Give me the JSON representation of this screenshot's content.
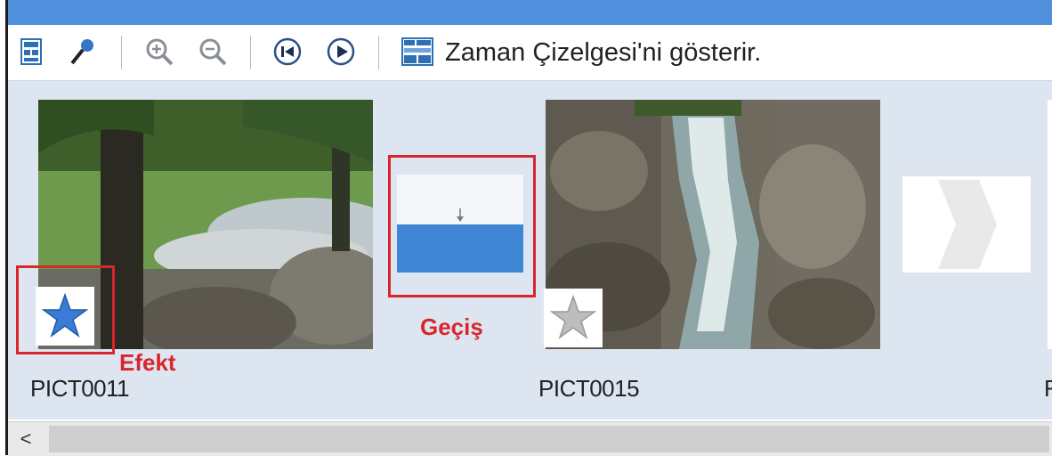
{
  "toolbar": {
    "buttons": [
      {
        "name": "storyboard-icon"
      },
      {
        "name": "narrate-mic-icon"
      },
      {
        "name": "zoom-in-icon"
      },
      {
        "name": "zoom-out-icon"
      },
      {
        "name": "rewind-icon"
      },
      {
        "name": "play-icon"
      },
      {
        "name": "timeline-icon"
      }
    ],
    "show_timeline_label": "Zaman Çizelgesi'ni gösterir."
  },
  "storyboard": {
    "clips": [
      {
        "name": "PICT0011",
        "has_effect": true
      },
      {
        "name": "PICT0015",
        "has_effect": false
      }
    ],
    "annotations": {
      "effect_label": "Efekt",
      "transition_label": "Geçiş"
    },
    "partial_next_clip_label": "F"
  },
  "colors": {
    "titlebar": "#4f8fdc",
    "storyboard_bg": "#dde6f0",
    "annotation_red": "#d9262c",
    "transition_blue": "#3f86d6"
  },
  "scrollbar": {
    "left_arrow": "<"
  }
}
